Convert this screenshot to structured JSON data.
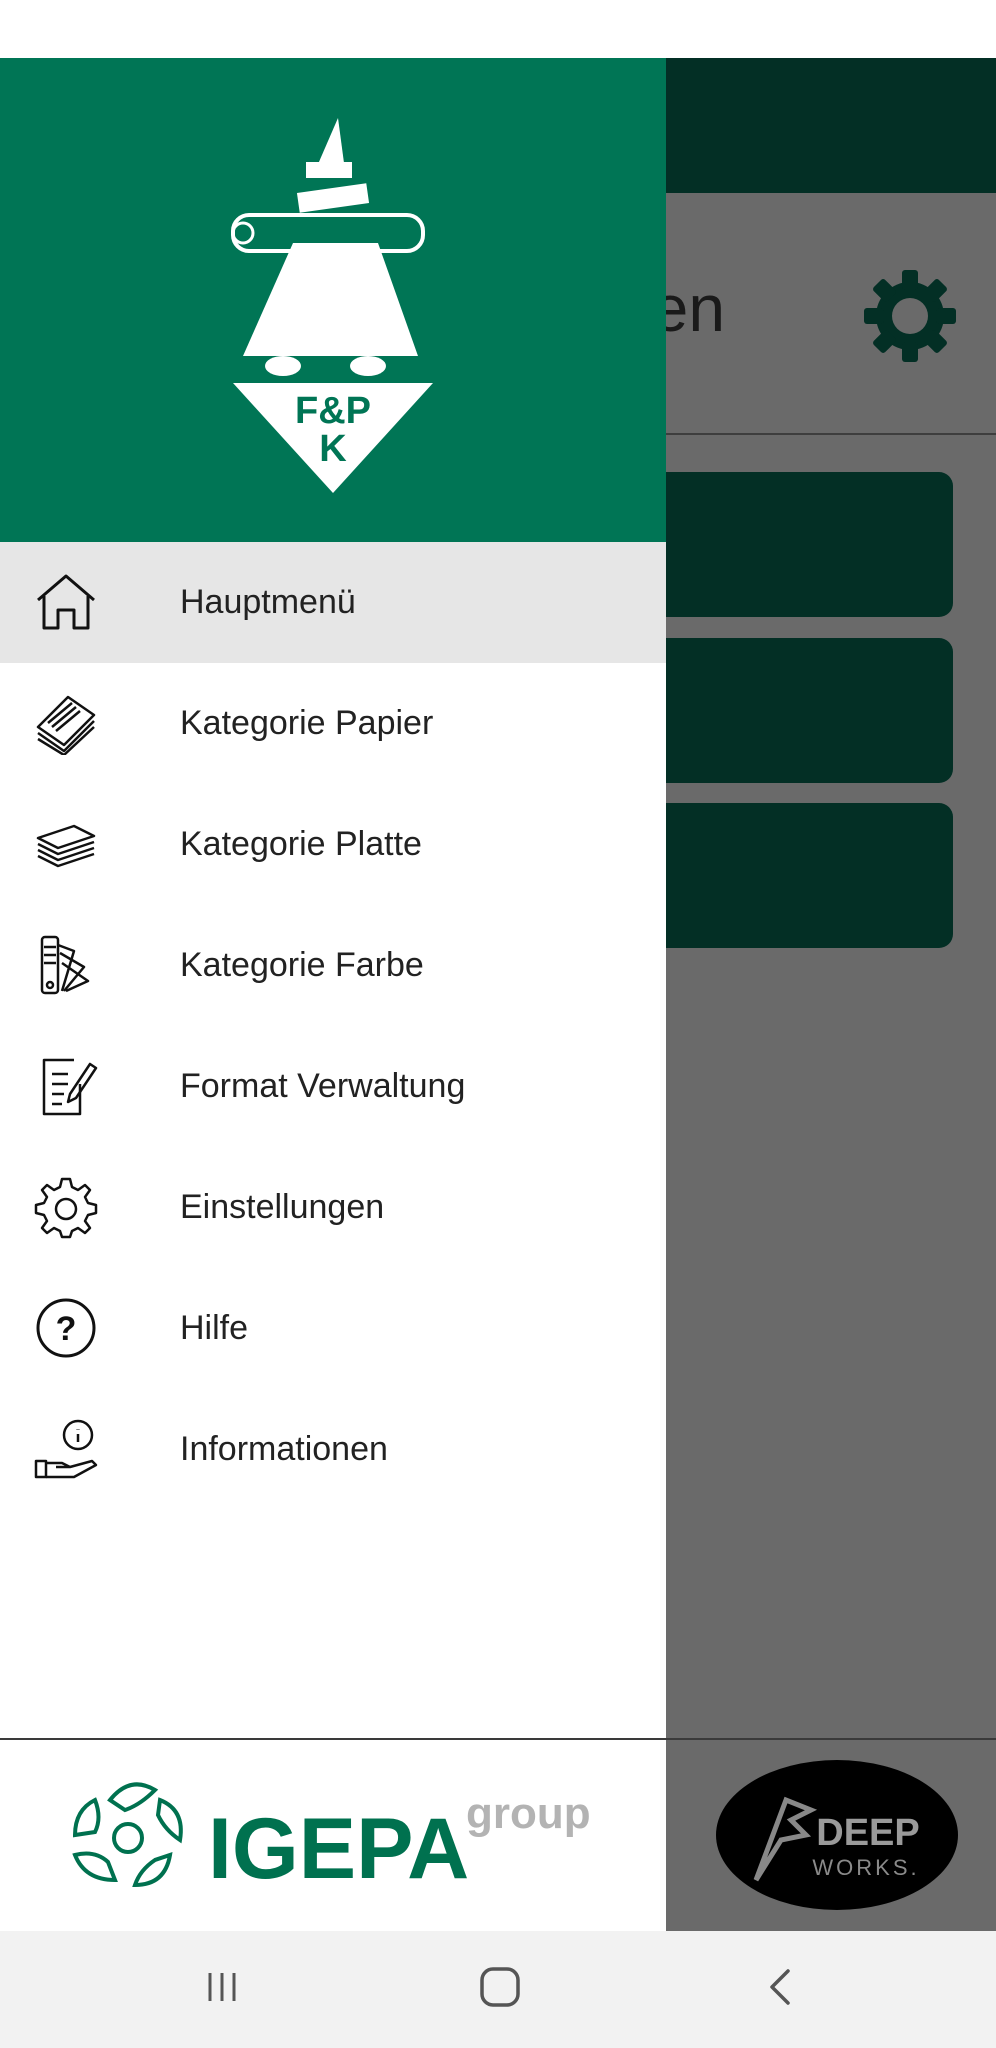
{
  "background_app": {
    "title_fragment": "ersen"
  },
  "drawer": {
    "header_logo": {
      "text_line1": "F&P",
      "text_line2": "K"
    },
    "items": [
      {
        "label": "Hauptmenü",
        "icon": "home-icon",
        "active": true
      },
      {
        "label": "Kategorie Papier",
        "icon": "paper-stack-icon",
        "active": false
      },
      {
        "label": "Kategorie Platte",
        "icon": "board-stack-icon",
        "active": false
      },
      {
        "label": "Kategorie Farbe",
        "icon": "color-swatch-icon",
        "active": false
      },
      {
        "label": "Format Verwaltung",
        "icon": "edit-document-icon",
        "active": false
      },
      {
        "label": "Einstellungen",
        "icon": "gear-icon",
        "active": false
      },
      {
        "label": "Hilfe",
        "icon": "help-icon",
        "active": false
      },
      {
        "label": "Informationen",
        "icon": "info-hand-icon",
        "active": false
      }
    ],
    "footer_logo": {
      "brand": "IGEPA",
      "suffix": "group"
    }
  },
  "footer_right_logo": {
    "line1": "DEEP",
    "line2": "WORKS."
  },
  "system_nav": {
    "recent": "recent-apps-icon",
    "home": "home-button-icon",
    "back": "back-icon"
  },
  "colors": {
    "drawer_header": "#007555",
    "dark_green": "#032f25",
    "scrim": "#6a6a6a",
    "active_item": "#e6e6e6",
    "igepa_green": "#00714f",
    "igepa_gray": "#b3b3b3"
  }
}
